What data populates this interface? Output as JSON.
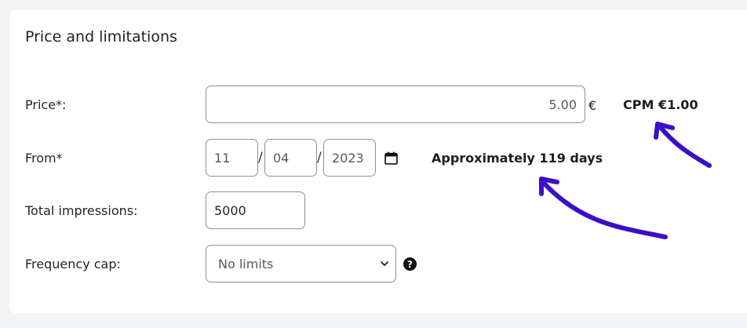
{
  "section": {
    "title": "Price and limitations"
  },
  "price": {
    "label": "Price*:",
    "value": "5.00",
    "currency": "€",
    "cpm": "CPM €1.00"
  },
  "from": {
    "label": "From*",
    "day": "11",
    "month": "04",
    "year": "2023",
    "separator": "/",
    "duration": "Approximately 119 days",
    "calendar_icon": "calendar-icon"
  },
  "impressions": {
    "label": "Total impressions:",
    "value": "5000"
  },
  "frequency": {
    "label": "Frequency cap:",
    "selected": "No limits",
    "chevron_icon": "chevron-down-icon",
    "help_icon": "question-circle-icon",
    "help_glyph": "?"
  },
  "annotation": {
    "arrow_color": "#3a0fc7"
  }
}
